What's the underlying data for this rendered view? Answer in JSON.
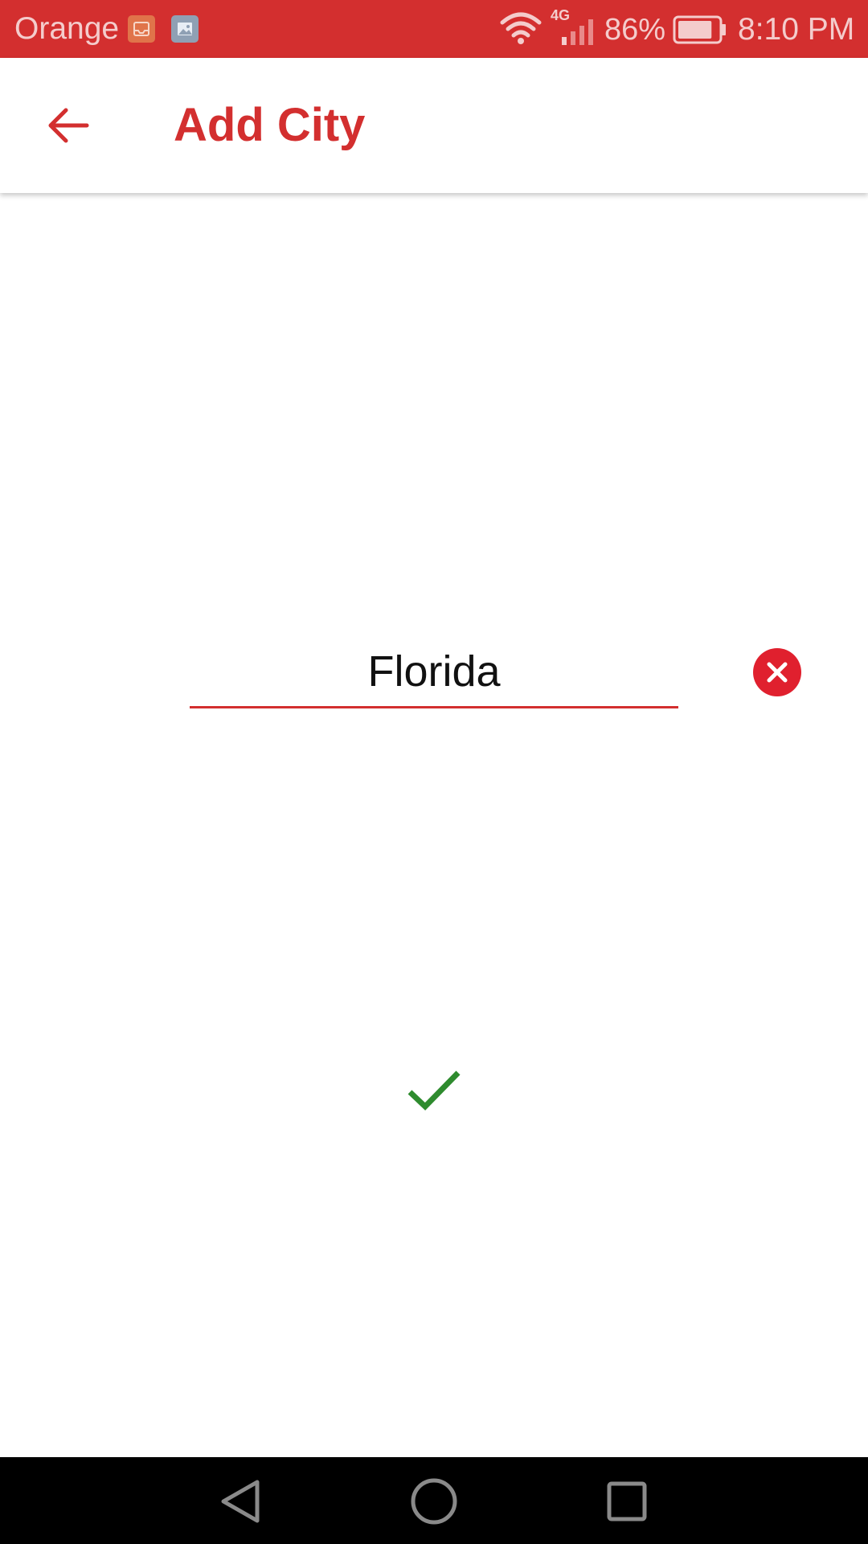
{
  "status_bar": {
    "carrier": "Orange",
    "network_type": "4G",
    "battery_percent": "86%",
    "battery_level": 0.86,
    "time": "8:10 PM",
    "notification_icons": [
      "inbox-icon",
      "gallery-icon"
    ],
    "system_icons": [
      "wifi-icon",
      "signal-icon",
      "battery-icon"
    ]
  },
  "app_bar": {
    "title": "Add City",
    "back_icon": "arrow-left-icon"
  },
  "city_input": {
    "value": "Florida",
    "clear_icon": "close-circle-icon"
  },
  "confirm_icon": "checkmark-icon",
  "nav_bar": {
    "icons": [
      "back-triangle-icon",
      "home-circle-icon",
      "recents-square-icon"
    ]
  },
  "colors": {
    "primary": "#d32f2f",
    "clear_button": "#e0202e",
    "confirm": "#2e8b2e",
    "nav_background": "#000000"
  }
}
